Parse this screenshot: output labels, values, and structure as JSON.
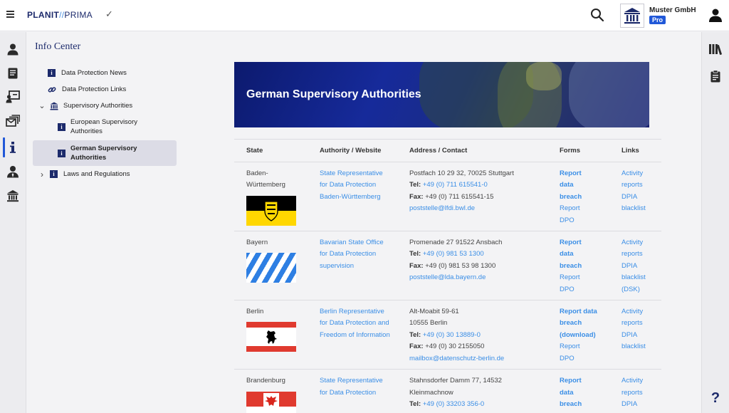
{
  "header": {
    "logo_part1": "PLANIT",
    "logo_sep": "//",
    "logo_part2": "PRIMA",
    "check": "✓",
    "company_name": "Muster GmbH",
    "plan_badge": "Pro"
  },
  "left_rail": [
    "person-icon",
    "book-icon",
    "presentation-icon",
    "mail-stack-icon",
    "info-icon",
    "admin-user-icon",
    "institution-icon"
  ],
  "right_rail": [
    "library-icon",
    "clipboard-icon",
    "help-icon"
  ],
  "help_label": "?",
  "nav": {
    "title": "Info Center",
    "items": [
      {
        "label": "Data Protection News"
      },
      {
        "label": "Data Protection Links"
      },
      {
        "label": "Supervisory Authorities",
        "chevron": "⌄"
      },
      {
        "label": "European Supervisory Authorities"
      },
      {
        "label": "German Supervisory Authorities"
      },
      {
        "label": "Laws and Regulations",
        "chevron": "›"
      }
    ]
  },
  "banner": {
    "title": "German Supervisory Authorities"
  },
  "table": {
    "headers": [
      "State",
      "Authority / Website",
      "Address / Contact",
      "Forms",
      "Links"
    ],
    "rows": [
      {
        "state": "Baden-Württemberg",
        "authority": "State Representative for Data Protection Baden-Württemberg",
        "addr1": "Postfach 10 29 32, 70025 Stuttgart",
        "addr2": "",
        "tel_label": "Tel:",
        "tel": "+49 (0) 711 615541-0",
        "fax_label": "Fax:",
        "fax": "+49 (0) 711 615541-15",
        "email": "poststelle@lfdi.bwl.de",
        "forms": [
          "Report data breach",
          "Report DPO"
        ],
        "links": [
          "Activity reports",
          "DPIA blacklist"
        ]
      },
      {
        "state": "Bayern",
        "authority": "Bavarian State Office for Data Protection supervision",
        "addr1": "Promenade 27 91522 Ansbach",
        "addr2": "",
        "tel_label": "Tel:",
        "tel": "+49 (0) 981 53 1300",
        "fax_label": "Fax:",
        "fax": "+49 (0) 981 53 98 1300",
        "email": "poststelle@lda.bayern.de",
        "forms": [
          "Report data breach",
          "Report DPO"
        ],
        "links": [
          "Activity reports",
          "DPIA blacklist (DSK)"
        ]
      },
      {
        "state": "Berlin",
        "authority": "Berlin Representative for Data Protection and Freedom of Information",
        "addr1": "Alt-Moabit 59-61",
        "addr2": "10555 Berlin",
        "tel_label": "Tel:",
        "tel": "+49 (0) 30 13889-0",
        "fax_label": "Fax:",
        "fax": "+49 (0) 30 2155050",
        "email": "mailbox@datenschutz-berlin.de",
        "forms": [
          "Report data breach (download)",
          "Report DPO"
        ],
        "links": [
          "Activity reports",
          "DPIA blacklist"
        ]
      },
      {
        "state": "Brandenburg",
        "authority": "State Representative for Data Protection",
        "addr1": "Stahnsdorfer Damm 77, 14532 Kleinmachnow",
        "addr2": "",
        "tel_label": "Tel:",
        "tel": "+49 (0) 33203 356-0",
        "fax_label": "",
        "fax": "",
        "email": "",
        "forms": [
          "Report data breach"
        ],
        "links": [
          "Activity reports",
          "DPIA"
        ]
      }
    ]
  },
  "colors": {
    "brand": "#1c2a6b",
    "accent": "#2158d8",
    "link": "#3a8ee6"
  }
}
